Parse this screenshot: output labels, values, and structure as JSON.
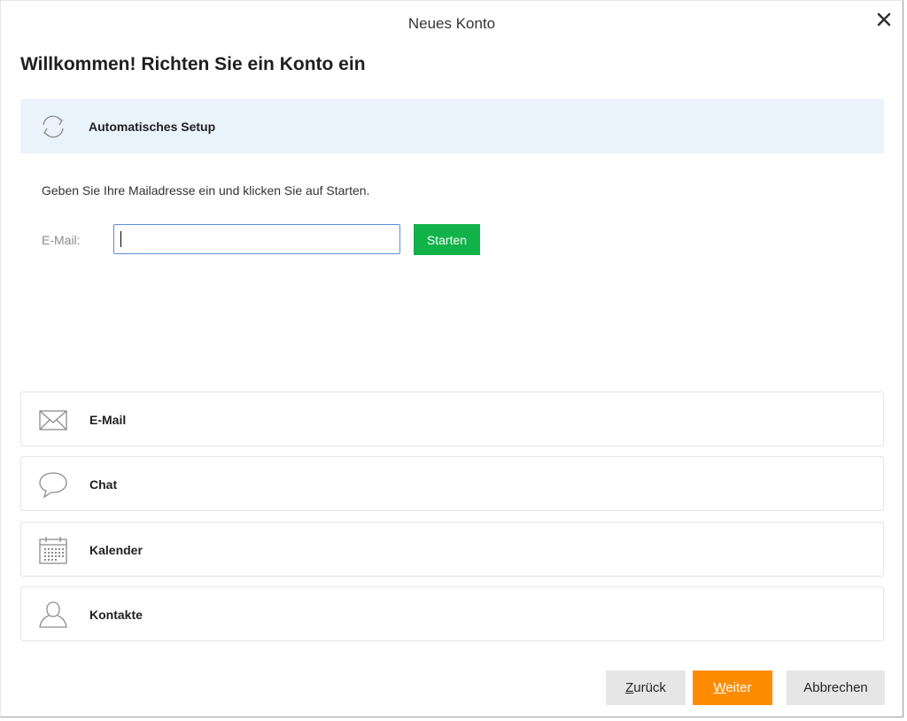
{
  "window": {
    "title": "Neues Konto",
    "close_glyph": "✕"
  },
  "heading": "Willkommen! Richten Sie ein Konto ein",
  "auto_setup": {
    "icon": "refresh-icon",
    "label": "Automatisches Setup",
    "instruction": "Geben Sie Ihre Mailadresse ein und klicken Sie auf Starten.",
    "email_label": "E-Mail:",
    "email_value": "",
    "start_label": "Starten"
  },
  "account_types": [
    {
      "icon": "envelope-icon",
      "label": "E-Mail"
    },
    {
      "icon": "chat-bubble-icon",
      "label": "Chat"
    },
    {
      "icon": "calendar-icon",
      "label": "Kalender"
    },
    {
      "icon": "person-icon",
      "label": "Kontakte"
    }
  ],
  "footer": {
    "back_access_key": "Z",
    "back_rest": "urück",
    "next_access_key": "W",
    "next_rest": "eiter",
    "cancel_label": "Abbrechen"
  },
  "colors": {
    "accent_orange": "#ff8c00",
    "start_green": "#11b24a",
    "setup_bg": "#eaf2fc"
  }
}
